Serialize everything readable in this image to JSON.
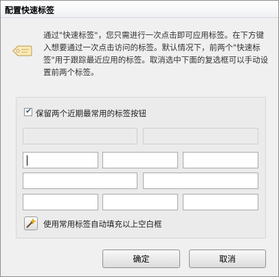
{
  "window": {
    "title": "配置快速标签"
  },
  "intro": {
    "text": "通过\"快速标签\"，您只需进行一次点击即可应用标签。在下方键入想要通过一次点击访问的标签。默认情况下，前两个\"快速标签\"用于跟踪最近应用的标签。取消选中下面的复选框可以手动设置前两个标签。",
    "icon": "tag-icon"
  },
  "group": {
    "checkbox_label": "保留两个近期最常用的标签按钮",
    "checkbox_checked": true,
    "autofill_label": "使用常用标签自动填充以上空白框"
  },
  "buttons": {
    "ok": "确定",
    "cancel": "取消"
  },
  "colors": {
    "accent": "#3a5d8f",
    "border": "#a9a9a9"
  }
}
